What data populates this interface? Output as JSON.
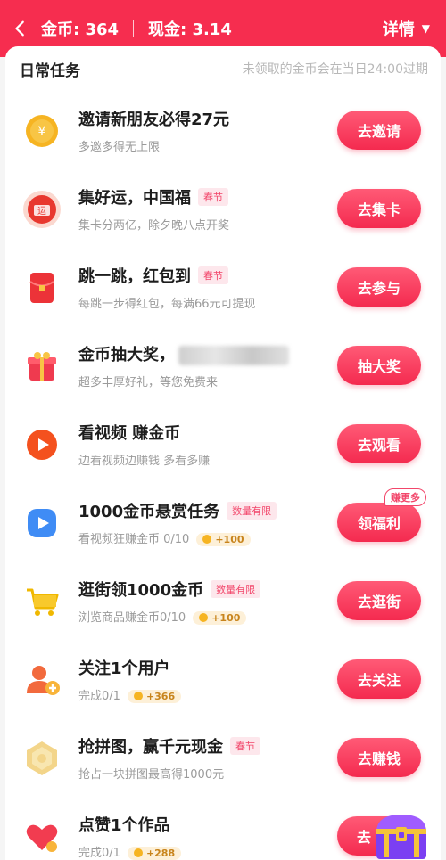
{
  "header": {
    "coins_text": "金币: 364",
    "cash_text": "现金: 3.14",
    "details_label": "详情"
  },
  "section": {
    "title": "日常任务",
    "note": "未领取的金币会在当日24:00过期"
  },
  "tasks": [
    {
      "title": "邀请新朋友必得27元",
      "tag": "",
      "subtitle": "多邀多得无上限",
      "reward": "",
      "button": "去邀请",
      "icon": "coin-icon"
    },
    {
      "title": "集好运，中国福",
      "tag": "春节",
      "subtitle": "集卡分两亿，除夕晚八点开奖",
      "reward": "",
      "button": "去集卡",
      "icon": "lucky-seal-icon"
    },
    {
      "title": "跳一跳，红包到",
      "tag": "春节",
      "subtitle": "每跳一步得红包，每满66元可提现",
      "reward": "",
      "button": "去参与",
      "icon": "red-envelope-icon"
    },
    {
      "title": "金币抽大奖，",
      "tag": "",
      "subtitle": "超多丰厚好礼，等您免费来",
      "reward": "",
      "button": "抽大奖",
      "icon": "gift-box-icon"
    },
    {
      "title": "看视频 赚金币",
      "tag": "",
      "subtitle": "边看视频边赚钱 多看多赚",
      "reward": "",
      "button": "去观看",
      "icon": "video-play-icon"
    },
    {
      "title": "1000金币悬赏任务",
      "tag": "数量有限",
      "subtitle": "看视频狂赚金币 0/10",
      "reward": "+100",
      "button": "领福利",
      "badge": "赚更多",
      "icon": "play-blue-icon"
    },
    {
      "title": "逛街领1000金币",
      "tag": "数量有限",
      "subtitle": "浏览商品赚金币0/10",
      "reward": "+100",
      "button": "去逛街",
      "icon": "shopping-cart-icon"
    },
    {
      "title": "关注1个用户",
      "tag": "",
      "subtitle": "完成0/1",
      "reward": "+366",
      "button": "去关注",
      "icon": "add-user-icon"
    },
    {
      "title": "抢拼图，赢千元现金",
      "tag": "春节",
      "subtitle": "抢占一块拼图最高得1000元",
      "reward": "",
      "button": "去赚钱",
      "icon": "puzzle-icon"
    },
    {
      "title": "点赞1个作品",
      "tag": "",
      "subtitle": "完成0/1",
      "reward": "+288",
      "button": "去",
      "icon": "heart-icon"
    }
  ],
  "colors": {
    "brand_red": "#f62d4f",
    "tag_pink": "#f2466a",
    "reward_gold": "#c8841c"
  }
}
